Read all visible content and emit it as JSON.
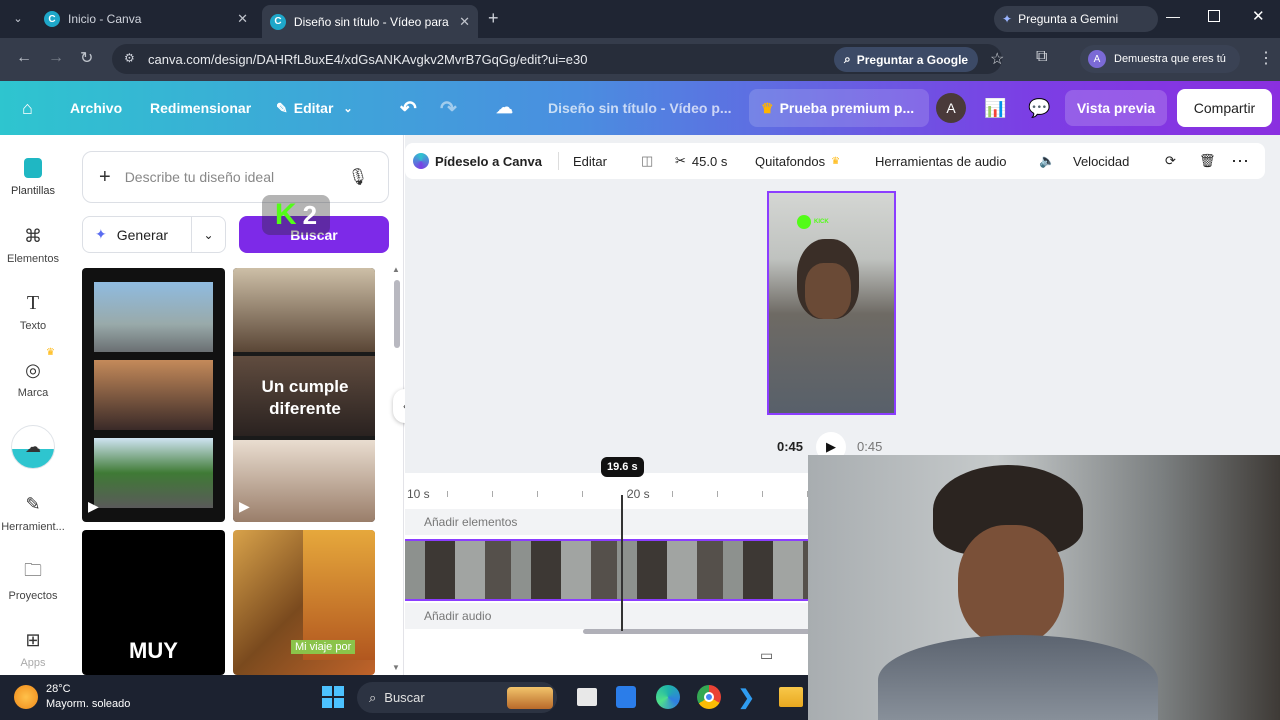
{
  "browser": {
    "tabs": [
      {
        "title": "Inicio - Canva",
        "active": false
      },
      {
        "title": "Diseño sin título - Vídeo para m",
        "active": true
      }
    ],
    "new_tab": "+",
    "gemini": "Pregunta a Gemini",
    "url": "canva.com/design/DAHRfL8uxE4/xdGsANKAvgkv2MvrB7GqGg/edit?ui=e30",
    "google_pill": "Preguntar a Google",
    "profile_text": "Demuestra que eres tú",
    "profile_initial": "A"
  },
  "header": {
    "archivo": "Archivo",
    "redimensionar": "Redimensionar",
    "editar": "Editar",
    "title": "Diseño sin título - Vídeo p...",
    "premium": "Prueba premium p...",
    "avatar": "A",
    "preview": "Vista previa",
    "share": "Compartir"
  },
  "sidebar": {
    "items": [
      {
        "label": "Plantillas",
        "icon": "templates-icon"
      },
      {
        "label": "Elementos",
        "icon": "elements-icon"
      },
      {
        "label": "Texto",
        "icon": "text-icon"
      },
      {
        "label": "Marca",
        "icon": "brand-icon"
      },
      {
        "label": "",
        "icon": "upload-icon"
      },
      {
        "label": "Herramient...",
        "icon": "tools-icon"
      },
      {
        "label": "Proyectos",
        "icon": "folder-icon"
      },
      {
        "label": "Apps",
        "icon": "apps-icon"
      }
    ]
  },
  "panel": {
    "search_placeholder": "Describe tu diseño ideal",
    "generate": "Generar",
    "search_button": "Buscar",
    "overlay_badge": "2",
    "thumb_texts": {
      "cumple": "Un cumple diferente",
      "muy": "MUY",
      "viaje": "Mi viaje por"
    }
  },
  "context_toolbar": {
    "ask_canva": "Pídeselo a Canva",
    "edit": "Editar",
    "duration": "45.0 s",
    "bg_remover": "Quitafondos",
    "audio_tools": "Herramientas de audio",
    "speed": "Velocidad"
  },
  "preview": {
    "badge_name": "KICK",
    "time_current": "0:45",
    "time_total": "0:45"
  },
  "timeline": {
    "playhead_label": "19.6 s",
    "ticks": [
      "10 s",
      "20 s"
    ],
    "add_elements": "Añadir elementos",
    "add_audio": "Añadir audio"
  },
  "taskbar": {
    "temperature": "28°C",
    "weather": "Mayorm. soleado",
    "search": "Buscar"
  },
  "colors": {
    "accent_purple": "#8b3dff",
    "teal": "#2ec5cf",
    "browser_dark": "#1f2533"
  }
}
